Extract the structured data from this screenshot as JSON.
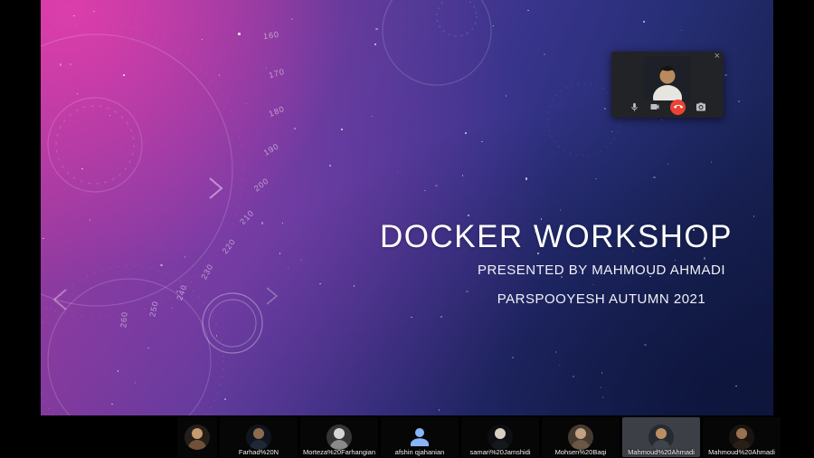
{
  "slide": {
    "title": "DOCKER WORKSHOP",
    "subtitle": "PRESENTED BY MAHMOUD AHMADI",
    "footer": "PARSPOOYESH AUTUMN 2021",
    "protractor_numbers": [
      "160",
      "170",
      "180",
      "190",
      "200",
      "210",
      "220",
      "230",
      "240",
      "250",
      "260"
    ]
  },
  "call_panel": {
    "close_icon": "×",
    "controls": [
      {
        "id": "mic",
        "icon": "mic-icon"
      },
      {
        "id": "camera",
        "icon": "videocam-icon"
      },
      {
        "id": "end-call",
        "icon": "call-end-icon",
        "color": "#ea4335"
      },
      {
        "id": "switch-camera",
        "icon": "camera-switch-icon"
      }
    ]
  },
  "filmstrip": {
    "participants": [
      {
        "label": "",
        "avatar": "photo",
        "narrow": true,
        "colors": [
          "#241d18",
          "#c59a6f",
          "#6f5138"
        ]
      },
      {
        "label": "Farhad%20N",
        "avatar": "photo",
        "colors": [
          "#10141c",
          "#8d6b4e",
          "#1f2836"
        ]
      },
      {
        "label": "Morteza%20Farhangian",
        "avatar": "photo",
        "colors": [
          "#343434",
          "#d6d6d6",
          "#8a8a8a"
        ]
      },
      {
        "label": "afshin qjahanian",
        "avatar": "blue-person",
        "colors": [
          "#8ab4f8"
        ]
      },
      {
        "label": "samari%20Jamshidi",
        "avatar": "photo",
        "colors": [
          "#0c0e12",
          "#d8cec2",
          "#14171c"
        ]
      },
      {
        "label": "Mohsen%20Baqi",
        "avatar": "photo",
        "colors": [
          "#463a2e",
          "#c2a184",
          "#6b5745"
        ]
      },
      {
        "label": "Mahmoud%20Ahmadi",
        "avatar": "photo",
        "highlighted": true,
        "colors": [
          "#262b31",
          "#bc8e62",
          "#3e444c"
        ]
      },
      {
        "label": "Mahmoud%20Ahmadi",
        "avatar": "photo",
        "colors": [
          "#191410",
          "#9b7250",
          "#281f17"
        ]
      }
    ]
  },
  "colors": {
    "end_call_red": "#ea4335",
    "avatar_blue": "#8ab4f8",
    "slide_pink": "#c23fa4",
    "slide_blue": "#1b2459"
  }
}
